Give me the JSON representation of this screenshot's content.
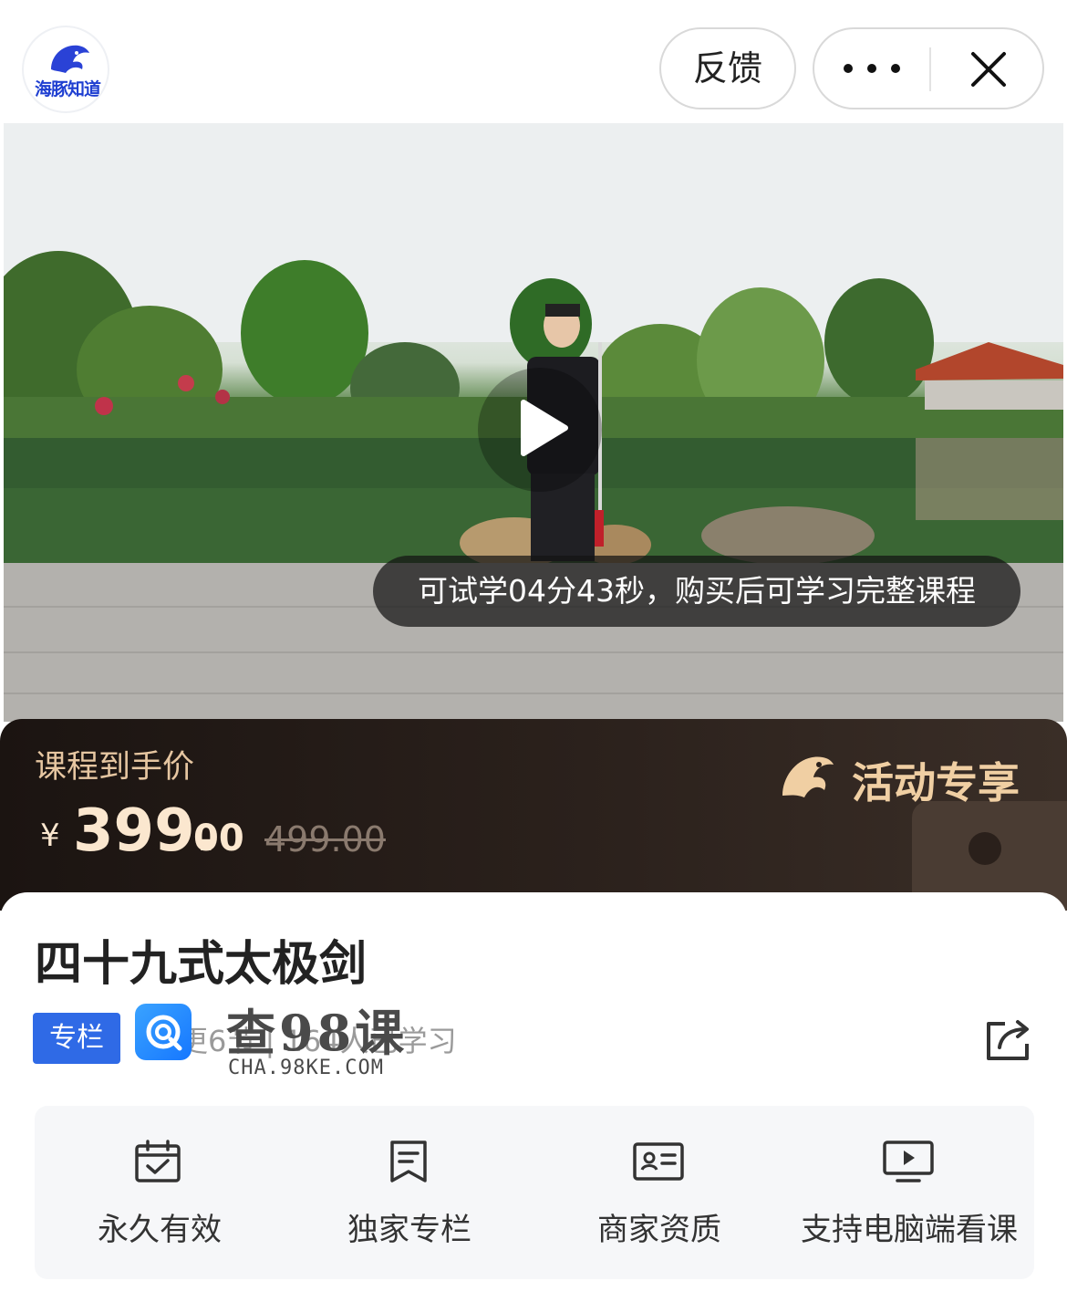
{
  "header": {
    "logo_text": "海豚知道",
    "feedback_label": "反馈",
    "more_icon": "more-dots-icon",
    "close_icon": "close-icon"
  },
  "video": {
    "play_icon": "play-icon",
    "trial_tip": "可试学04分43秒，购买后可学习完整课程"
  },
  "price": {
    "label": "课程到手价",
    "currency": "¥",
    "main": "399.",
    "decimals": "00",
    "original": "499.00",
    "promo_label": "活动专享"
  },
  "course": {
    "title": "四十九式太极剑",
    "tag": "专栏",
    "meta": "更6节 | 164人已学习",
    "watermark": "查98课",
    "watermark_url": "CHA.98KE.COM"
  },
  "features": [
    {
      "icon": "calendar-check-icon",
      "label": "永久有效"
    },
    {
      "icon": "bookmark-icon",
      "label": "独家专栏"
    },
    {
      "icon": "id-card-icon",
      "label": "商家资质"
    },
    {
      "icon": "monitor-play-icon",
      "label": "支持电脑端看课"
    }
  ],
  "colors": {
    "accent_blue": "#2f6ae6",
    "price_gold": "#fbe7cf",
    "banner_dark": "#1b1411"
  }
}
